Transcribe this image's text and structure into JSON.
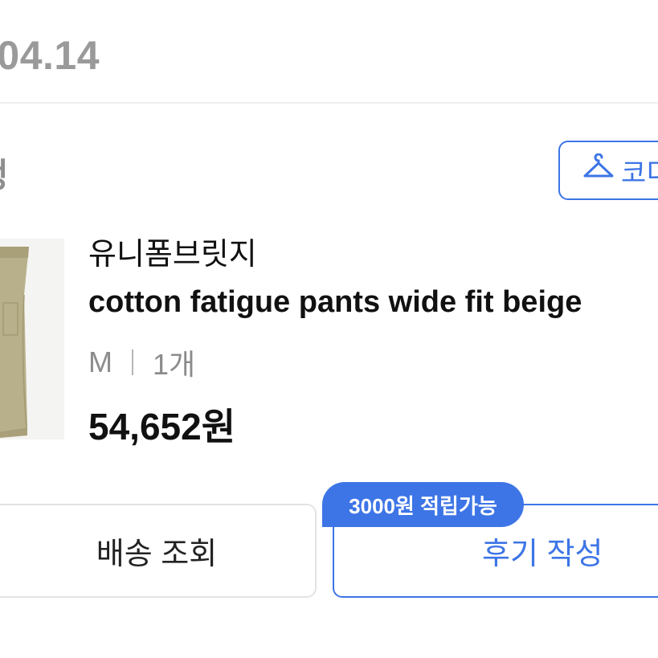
{
  "order": {
    "date": ".04.14",
    "status": "정"
  },
  "coordi_button": {
    "label": "코디",
    "icon": "hanger-icon"
  },
  "product": {
    "thumbnail_icon": "pants-thumbnail",
    "brand": "유니폼브릿지",
    "name": "cotton fatigue pants wide fit beige",
    "option_size": "M",
    "option_qty": "1개",
    "price": "54,652원"
  },
  "actions": {
    "shipping_label": "배송 조회",
    "review_label": "후기 작성",
    "reward_badge": "3000원 적립가능"
  },
  "colors": {
    "accent": "#3d75e6",
    "muted_text": "#8c8c8c",
    "border": "#e3e3e3",
    "pants_khaki": "#b8b08a"
  }
}
